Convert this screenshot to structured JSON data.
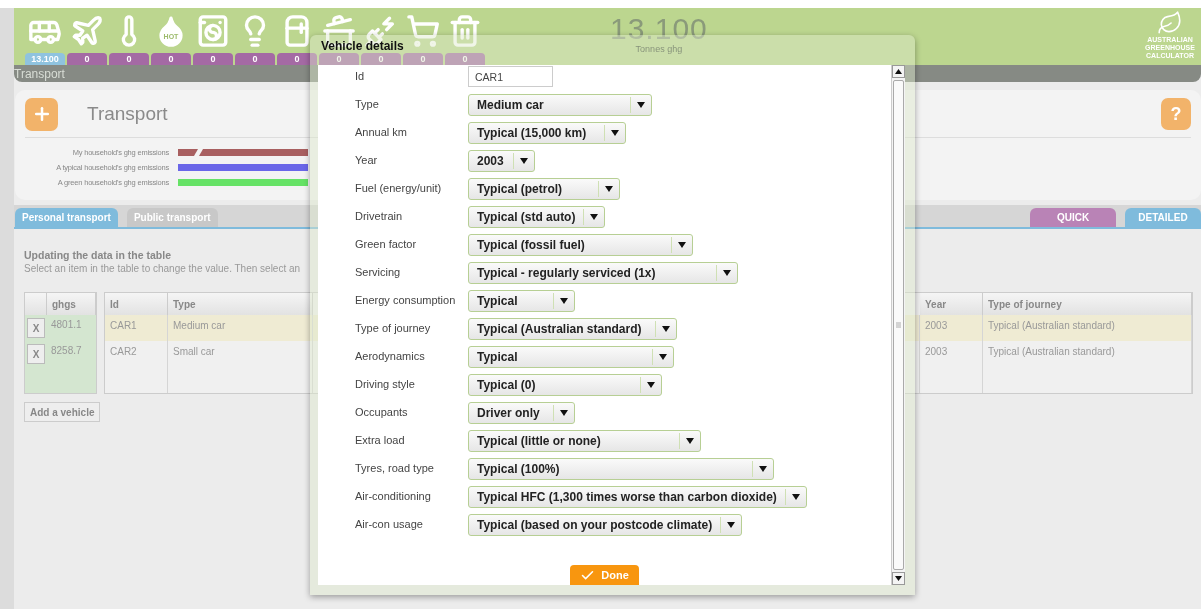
{
  "header": {
    "categories": [
      {
        "kind": "transport",
        "badge": "13.100",
        "selected": true
      },
      {
        "kind": "flight",
        "badge": "0",
        "selected": false
      },
      {
        "kind": "heating",
        "badge": "0",
        "selected": false
      },
      {
        "kind": "hot-water",
        "badge": "0",
        "selected": false,
        "icon_text": "HOT"
      },
      {
        "kind": "laundry",
        "badge": "0",
        "selected": false
      },
      {
        "kind": "lighting",
        "badge": "0",
        "selected": false
      },
      {
        "kind": "fridge",
        "badge": "0",
        "selected": false
      },
      {
        "kind": "cooking",
        "badge": "0",
        "selected": false
      },
      {
        "kind": "appliances",
        "badge": "0",
        "selected": false
      },
      {
        "kind": "shopping",
        "badge": "0",
        "selected": false
      },
      {
        "kind": "waste",
        "badge": "0",
        "selected": false
      }
    ],
    "total": "13.100",
    "total_unit": "Tonnes ghg",
    "logo_lines": [
      "AUSTRALIAN",
      "GREENHOUSE",
      "CALCULATOR"
    ]
  },
  "section_bar": "Transport",
  "card": {
    "title": "Transport",
    "help_button": "?",
    "legend": [
      {
        "label": "My household's ghg emissions",
        "color": "#a85f60",
        "broken": true
      },
      {
        "label": "A typical household's ghg emissions",
        "color": "#6a66e8",
        "broken": false
      },
      {
        "label": "A green household's ghg emissions",
        "color": "#66e266",
        "broken": false
      }
    ]
  },
  "tabs": [
    {
      "label": "Personal transport",
      "selected": true
    },
    {
      "label": "Public transport",
      "selected": false
    }
  ],
  "view_tabs": [
    {
      "label": "QUICK",
      "selected": false
    },
    {
      "label": "DETAILED",
      "selected": true
    }
  ],
  "instructions": {
    "title": "Updating the data in the table",
    "text": "Select an item in the table to change the value. Then select an"
  },
  "table": {
    "ghgs_header": "ghgs",
    "columns": [
      "Id",
      "Type",
      "Year",
      "Type of journey"
    ],
    "rows": [
      {
        "delete": "X",
        "ghgs": "4801.1",
        "cells": [
          "CAR1",
          "Medium car",
          "2003",
          "Typical (Australian standard)"
        ],
        "selected": true
      },
      {
        "delete": "X",
        "ghgs": "8258.7",
        "cells": [
          "CAR2",
          "Small car",
          "2003",
          "Typical (Australian standard)"
        ],
        "selected": false
      }
    ]
  },
  "add_button": "Add a vehicle",
  "modal": {
    "title": "Vehicle details",
    "done": "Done",
    "fields": [
      {
        "kind": "text",
        "label": "Id",
        "value": "CAR1"
      },
      {
        "kind": "select",
        "label": "Type",
        "value": "Medium car"
      },
      {
        "kind": "select",
        "label": "Annual km",
        "value": "Typical (15,000 km)"
      },
      {
        "kind": "select",
        "label": "Year",
        "value": "2003"
      },
      {
        "kind": "select",
        "label": "Fuel (energy/unit)",
        "value": "Typical (petrol)"
      },
      {
        "kind": "select",
        "label": "Drivetrain",
        "value": "Typical (std auto)"
      },
      {
        "kind": "select",
        "label": "Green factor",
        "value": "Typical (fossil fuel)"
      },
      {
        "kind": "select",
        "label": "Servicing",
        "value": "Typical - regularly serviced (1x)"
      },
      {
        "kind": "select",
        "label": "Energy consumption",
        "value": "Typical"
      },
      {
        "kind": "select",
        "label": "Type of journey",
        "value": "Typical (Australian standard)"
      },
      {
        "kind": "select",
        "label": "Aerodynamics",
        "value": "Typical"
      },
      {
        "kind": "select",
        "label": "Driving style",
        "value": "Typical (0)"
      },
      {
        "kind": "select",
        "label": "Occupants",
        "value": "Driver only"
      },
      {
        "kind": "select",
        "label": "Extra load",
        "value": "Typical (little or none)"
      },
      {
        "kind": "select",
        "label": "Tyres, road type",
        "value": "Typical (100%)"
      },
      {
        "kind": "select",
        "label": "Air-conditioning",
        "value": "Typical HFC (1,300 times worse than carbon dioxide)"
      },
      {
        "kind": "select",
        "label": "Air-con usage",
        "value": "Typical (based on your postcode climate)"
      }
    ]
  }
}
